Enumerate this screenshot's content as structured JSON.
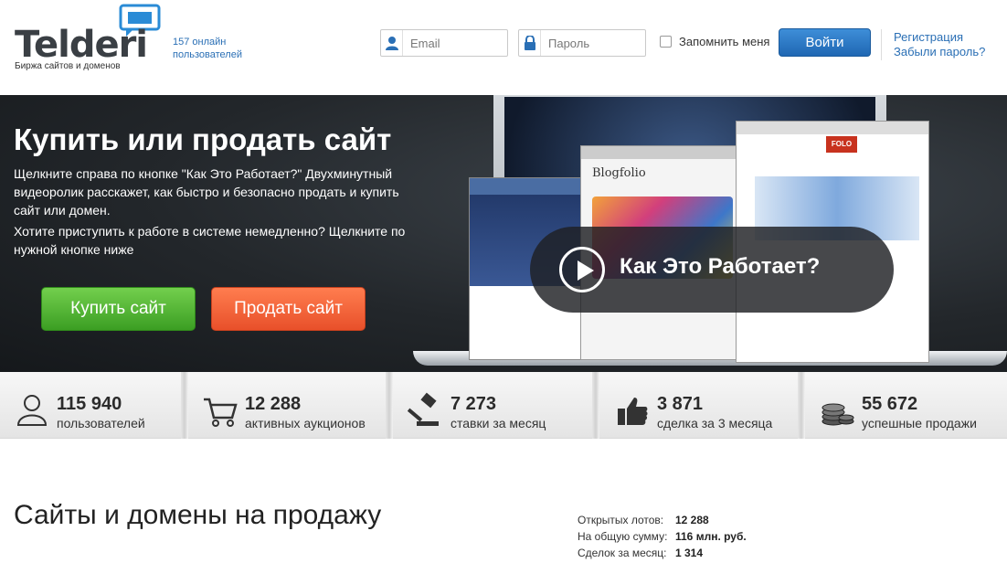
{
  "header": {
    "logo_text": "Telderi",
    "logo_subtitle": "Биржа сайтов и доменов",
    "online_count": "157 онлайн",
    "online_label": "пользователей",
    "email_placeholder": "Email",
    "password_placeholder": "Пароль",
    "remember_label": "Запомнить меня",
    "login_button": "Войти",
    "register_link": "Регистрация",
    "forgot_link": "Забыли пароль?"
  },
  "hero": {
    "title": "Купить или продать сайт",
    "paragraph1": "Щелкните справа по кнопке \"Как Это Работает?\" Двухминутный видеоролик расскажет, как быстро и безопасно продать и купить сайт или домен.",
    "paragraph2": "Хотите приступить к работе в системе немедленно? Щелкните по нужной кнопке ниже",
    "buy_button": "Купить сайт",
    "sell_button": "Продать сайт",
    "video_label": "Как Это Работает?",
    "preview_blog_title": "Blogfolio",
    "preview_logo": "FOLO"
  },
  "stats": [
    {
      "icon": "user-icon",
      "value": "115 940",
      "label": "пользователей"
    },
    {
      "icon": "cart-icon",
      "value": "12 288",
      "label": "активных аукционов"
    },
    {
      "icon": "gavel-icon",
      "value": "7 273",
      "label": "ставки за месяц"
    },
    {
      "icon": "thumbs-up-icon",
      "value": "3 871",
      "label": "сделка за 3 месяца"
    },
    {
      "icon": "coins-icon",
      "value": "55 672",
      "label": "успешные продажи"
    }
  ],
  "section": {
    "title": "Сайты и домены на продажу",
    "lots": [
      {
        "label": "Открытых лотов:",
        "value": "12 288"
      },
      {
        "label": "На общую сумму:",
        "value": "116 млн. руб."
      },
      {
        "label": "Сделок за месяц:",
        "value": "1 314"
      }
    ]
  },
  "colors": {
    "accent_blue": "#2a6fb5",
    "buy_green": "#4cb52f",
    "sell_orange": "#f0643a"
  }
}
